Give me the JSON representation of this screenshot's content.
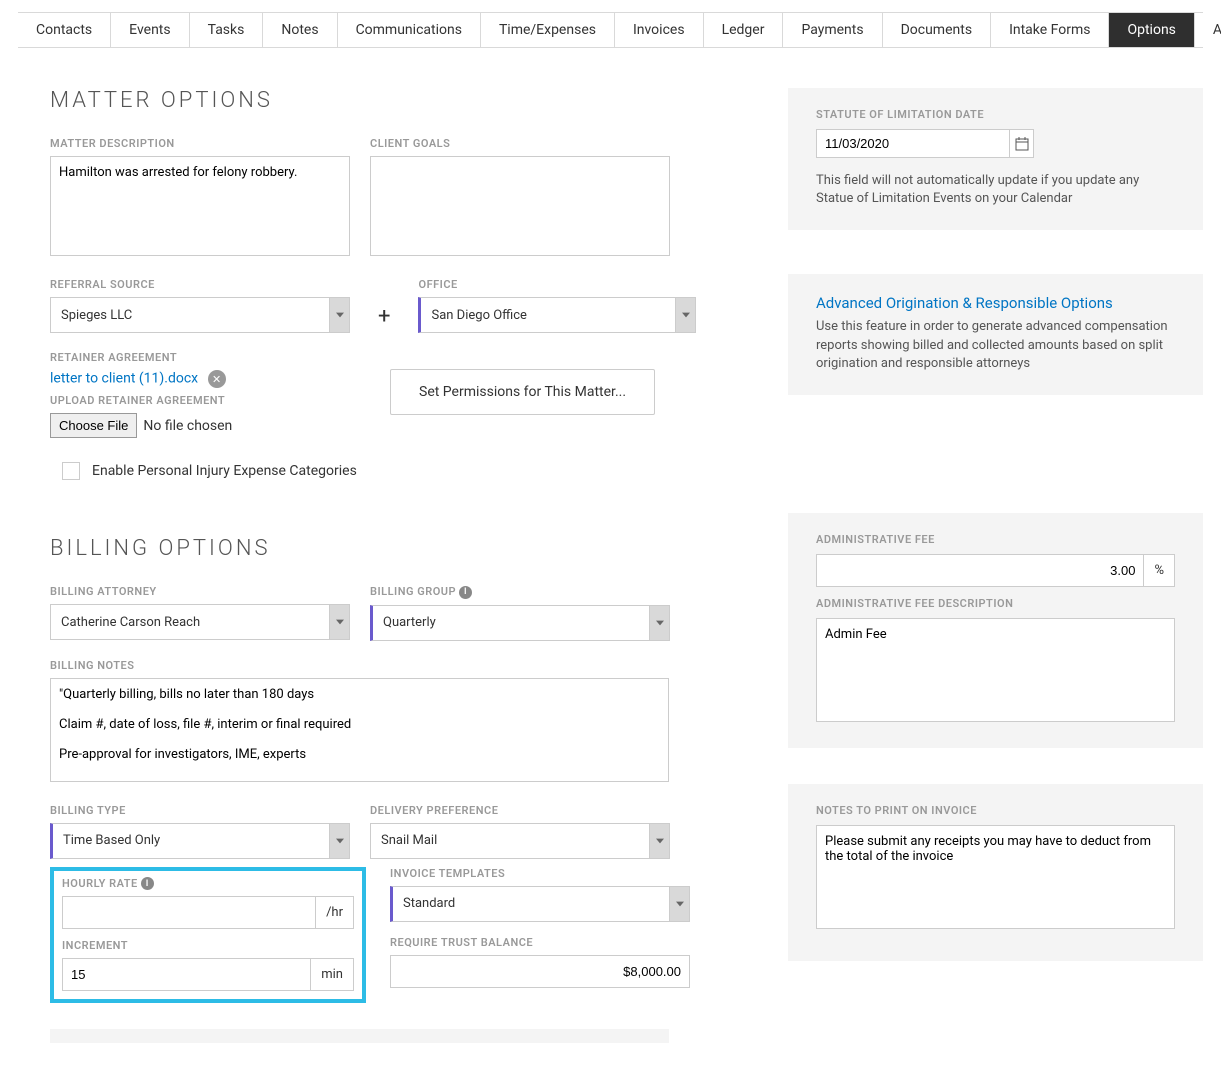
{
  "tabs": {
    "contacts": "Contacts",
    "events": "Events",
    "tasks": "Tasks",
    "notes": "Notes",
    "communications": "Communications",
    "time_expenses": "Time/Expenses",
    "invoices": "Invoices",
    "ledger": "Ledger",
    "payments": "Payments",
    "documents": "Documents",
    "intake_forms": "Intake Forms",
    "options": "Options",
    "activity_log": "Activity Log"
  },
  "sections": {
    "matter_options": "MATTER OPTIONS",
    "billing_options": "BILLING OPTIONS"
  },
  "matter": {
    "description_label": "MATTER DESCRIPTION",
    "description_value": "Hamilton was arrested for felony robbery.",
    "client_goals_label": "CLIENT GOALS",
    "client_goals_value": "",
    "referral_source_label": "REFERRAL SOURCE",
    "referral_source_value": "Spieges LLC",
    "office_label": "OFFICE",
    "office_value": "San Diego Office",
    "retainer_label": "RETAINER AGREEMENT",
    "retainer_file": "letter to client (11).docx",
    "upload_retainer_label": "UPLOAD RETAINER AGREEMENT",
    "choose_file": "Choose File",
    "no_file": "No file chosen",
    "permissions_btn": "Set Permissions for This Matter...",
    "pi_checkbox_label": "Enable Personal Injury Expense Categories",
    "plus": "+"
  },
  "statute": {
    "label": "STATUTE OF LIMITATION DATE",
    "value": "11/03/2020",
    "helper": "This field will not automatically update if you update any Statue of Limitation Events on your Calendar"
  },
  "advanced": {
    "link": "Advanced Origination & Responsible Options",
    "desc": "Use this feature in order to generate advanced compensation reports showing billed and collected amounts based on split origination and responsible attorneys"
  },
  "billing": {
    "attorney_label": "BILLING ATTORNEY",
    "attorney_value": "Catherine Carson Reach",
    "group_label": "BILLING GROUP",
    "group_value": "Quarterly",
    "notes_label": "BILLING NOTES",
    "notes_value": "\"Quarterly billing, bills no later than 180 days\n\nClaim #, date of loss, file #, interim or final required\n\nPre-approval for investigators, IME, experts",
    "type_label": "BILLING TYPE",
    "type_value": "Time Based Only",
    "delivery_label": "DELIVERY PREFERENCE",
    "delivery_value": "Snail Mail",
    "hourly_label": "HOURLY RATE",
    "hourly_value": "",
    "hourly_suffix": "/hr",
    "increment_label": "INCREMENT",
    "increment_value": "15",
    "increment_suffix": "min",
    "templates_label": "INVOICE TEMPLATES",
    "templates_value": "Standard",
    "trust_label": "REQUIRE TRUST BALANCE",
    "trust_value": "$8,000.00"
  },
  "admin_fee": {
    "label": "ADMINISTRATIVE FEE",
    "value": "3.00",
    "suffix": "%",
    "desc_label": "ADMINISTRATIVE FEE DESCRIPTION",
    "desc_value": "Admin Fee"
  },
  "invoice_notes": {
    "label": "NOTES TO PRINT ON INVOICE",
    "value": "Please submit any receipts you may have to deduct from the total of the invoice"
  },
  "icons": {
    "info": "i",
    "close": "✕"
  }
}
